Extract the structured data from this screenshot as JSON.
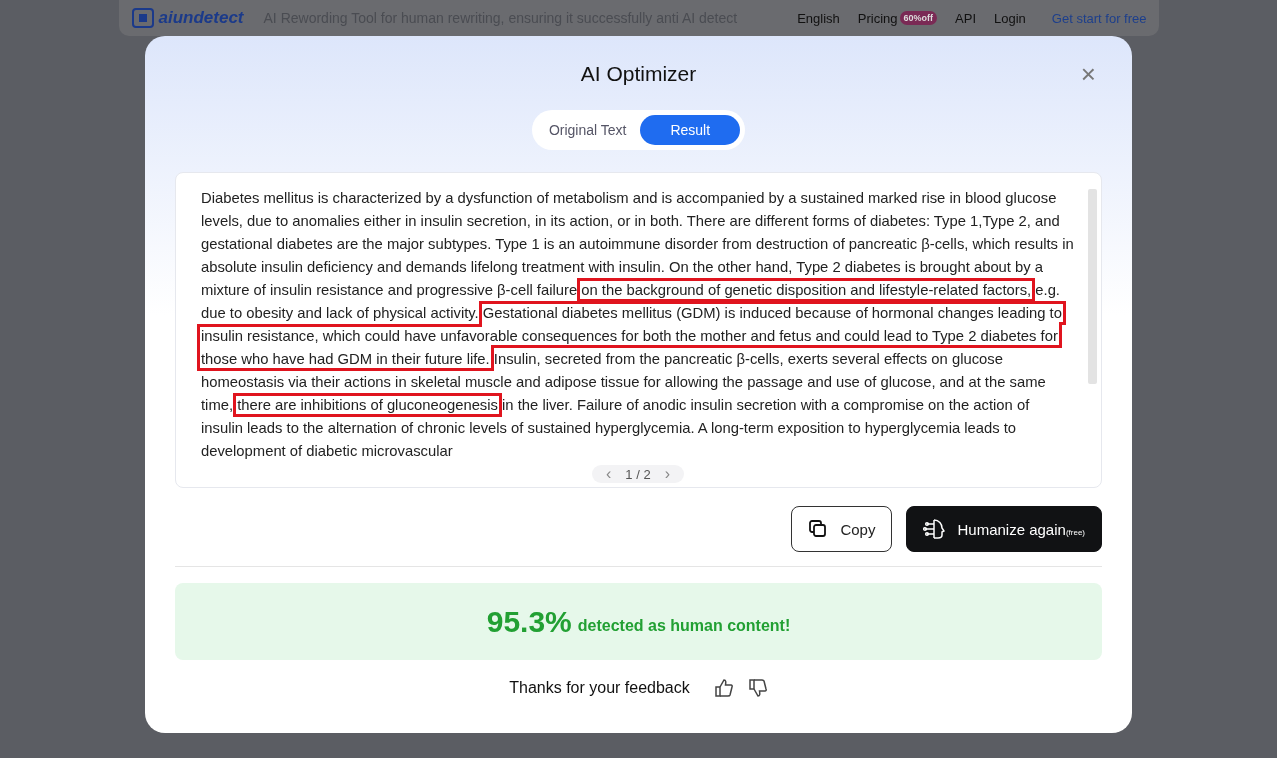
{
  "site_header": {
    "logo": "aiundetect",
    "tagline": "AI Rewording Tool for human rewriting, ensuring it successfully anti AI detect",
    "nav": [
      {
        "label": "English",
        "kind": "link"
      },
      {
        "label": "Pricing",
        "kind": "link",
        "badge": "60%off"
      },
      {
        "label": "API",
        "kind": "link"
      },
      {
        "label": "Login",
        "kind": "link"
      },
      {
        "label": "Get start for free",
        "kind": "cta"
      }
    ]
  },
  "dialog": {
    "title": "AI Optimizer",
    "close": "×",
    "tabs": [
      {
        "label": "Original Text",
        "selected": false
      },
      {
        "label": "Result",
        "selected": true
      }
    ],
    "result_segments": [
      {
        "text": "Diabetes mellitus is characterized by a dysfunction of metabolism and is accompanied by a sustained marked rise in blood glucose levels, due to anomalies either in insulin secretion, in its action, or in both. There are different forms of diabetes: Type 1,Type 2, and gestational diabetes are the major subtypes. Type 1 is an autoimmune disorder from destruction of pancreatic β-cells, which results in absolute insulin deficiency and demands lifelong treatment with insulin. On the other hand, Type 2 diabetes is brought about by a mixture of insulin resistance and progressive β-cell failure ",
        "highlighted": false
      },
      {
        "text": "on the background of genetic disposition and lifestyle-related factors,",
        "highlighted": true
      },
      {
        "text": " e.g. due to obesity and lack of physical activity. ",
        "highlighted": false
      },
      {
        "text": "Gestational diabetes mellitus (GDM) is induced because of hormonal changes leading to insulin resistance, which could have unfavorable consequences for both the mother and fetus and could lead to Type 2 diabetes for those who have had GDM in their future life.",
        "highlighted": true
      },
      {
        "text": " Insulin, secreted from the pancreatic β-cells, exerts several effects on glucose homeostasis via their actions in skeletal muscle and adipose tissue for allowing the passage and use of glucose, and at the same time, ",
        "highlighted": false
      },
      {
        "text": "there are inhibitions of gluconeogenesis",
        "highlighted": true
      },
      {
        "text": " in the liver. Failure of anodic insulin secretion with a compromise on the action of insulin leads to the alternation of chronic levels of sustained hyperglycemia. A long-term exposition to hyperglycemia leads to development of diabetic microvascular",
        "highlighted": false
      }
    ],
    "pager": {
      "prev": "‹",
      "page": "1 / 2",
      "next": "›"
    },
    "buttons": [
      {
        "label": "Copy",
        "kind": "outline"
      },
      {
        "label": "Humanize again",
        "suffix": "(free)",
        "kind": "dark"
      }
    ],
    "score": {
      "value": "95.3%",
      "text": "detected as human content!"
    },
    "feedback": {
      "text": "Thanks for your feedback"
    }
  }
}
